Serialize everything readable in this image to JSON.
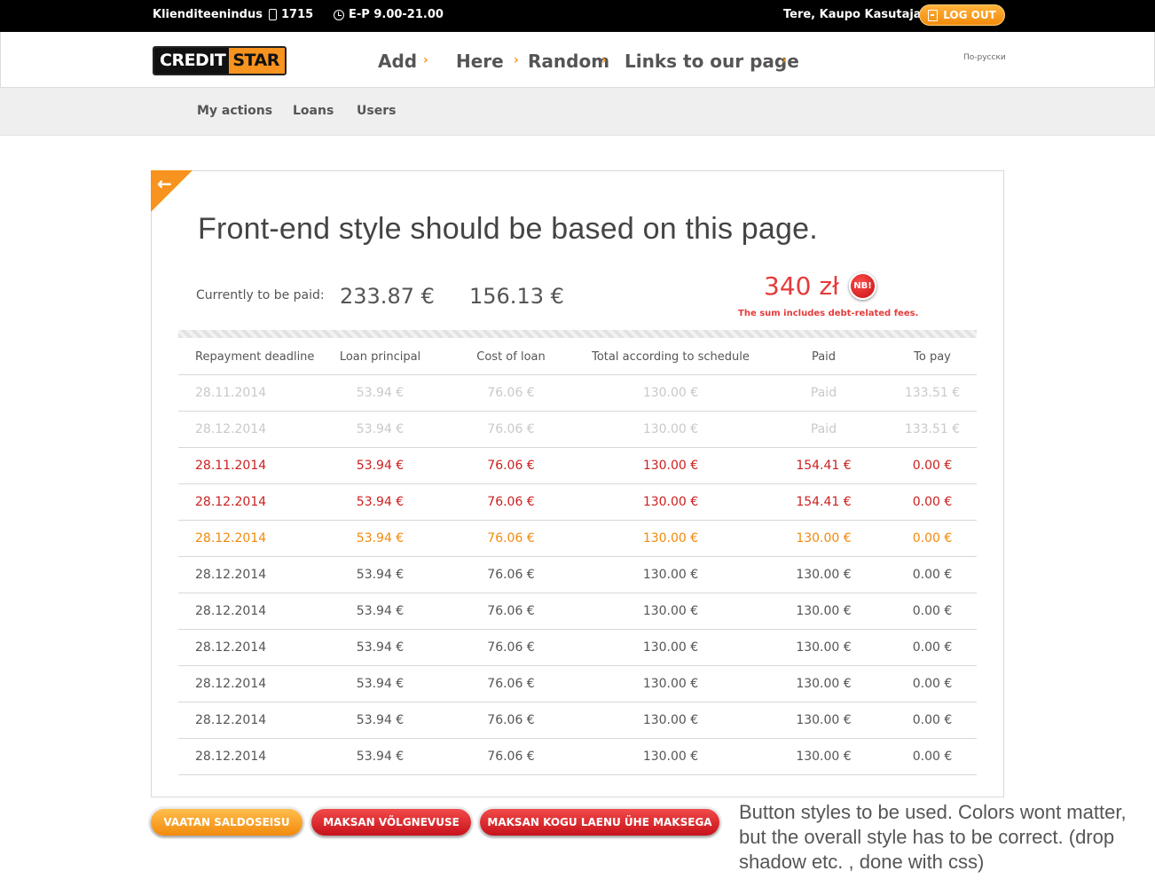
{
  "topbar": {
    "service": "Klienditeenindus",
    "phone": "1715",
    "hours": "E-P 9.00-21.00",
    "greeting": "Tere, Kaupo Kasutaja",
    "logout": "LOG OUT"
  },
  "header": {
    "logo_part1": "CREDIT",
    "logo_part2": "STAR",
    "nav": [
      "Add",
      "Here",
      "Random",
      "Links to our page"
    ],
    "chevron": "›",
    "language": "По-русски"
  },
  "subnav": [
    "My actions",
    "Loans",
    "Users"
  ],
  "card": {
    "title": "Front-end style should be based on this page.",
    "sum_label": "Currently to be paid:",
    "amount1": "233.87 €",
    "amount2": "156.13 €",
    "due_amount": "340 zł",
    "nb_badge": "NB!",
    "due_note": "The sum includes debt-related fees."
  },
  "table": {
    "headers": [
      "Repayment deadline",
      "Loan principal",
      "Cost of loan",
      "Total according to schedule",
      "Paid",
      "To pay"
    ],
    "rows": [
      {
        "status": "paid",
        "cells": [
          "28.11.2014",
          "53.94 €",
          "76.06 €",
          "130.00 €",
          "Paid",
          "133.51 €"
        ]
      },
      {
        "status": "paid",
        "cells": [
          "28.12.2014",
          "53.94 €",
          "76.06 €",
          "130.00 €",
          "Paid",
          "133.51 €"
        ]
      },
      {
        "status": "overdue",
        "cells": [
          "28.11.2014",
          "53.94 €",
          "76.06 €",
          "130.00 €",
          "154.41 €",
          "0.00 €"
        ]
      },
      {
        "status": "overdue",
        "cells": [
          "28.12.2014",
          "53.94 €",
          "76.06 €",
          "130.00 €",
          "154.41 €",
          "0.00 €"
        ]
      },
      {
        "status": "partial",
        "cells": [
          "28.12.2014",
          "53.94 €",
          "76.06 €",
          "130.00 €",
          "130.00 €",
          "0.00 €"
        ]
      },
      {
        "status": "normal",
        "cells": [
          "28.12.2014",
          "53.94 €",
          "76.06 €",
          "130.00 €",
          "130.00 €",
          "0.00 €"
        ]
      },
      {
        "status": "normal",
        "cells": [
          "28.12.2014",
          "53.94 €",
          "76.06 €",
          "130.00 €",
          "130.00 €",
          "0.00 €"
        ]
      },
      {
        "status": "normal",
        "cells": [
          "28.12.2014",
          "53.94 €",
          "76.06 €",
          "130.00 €",
          "130.00 €",
          "0.00 €"
        ]
      },
      {
        "status": "normal",
        "cells": [
          "28.12.2014",
          "53.94 €",
          "76.06 €",
          "130.00 €",
          "130.00 €",
          "0.00 €"
        ]
      },
      {
        "status": "normal",
        "cells": [
          "28.12.2014",
          "53.94 €",
          "76.06 €",
          "130.00 €",
          "130.00 €",
          "0.00 €"
        ]
      },
      {
        "status": "normal",
        "cells": [
          "28.12.2014",
          "53.94 €",
          "76.06 €",
          "130.00 €",
          "130.00 €",
          "0.00 €"
        ]
      }
    ]
  },
  "buttons": {
    "view_balance": "VAATAN SALDOSEISU",
    "pay_debt": "MAKSAN VÕLGNEVUSE",
    "pay_all": "MAKSAN KOGU LAENU ÜHE MAKSEGA"
  },
  "note": "Button styles to be used. Colors wont matter, but the overall style has to be correct. (drop shadow etc. , done with css)",
  "colors": {
    "accent": "#f7931e",
    "danger": "#cc1f1f",
    "topbar": "#000000"
  }
}
